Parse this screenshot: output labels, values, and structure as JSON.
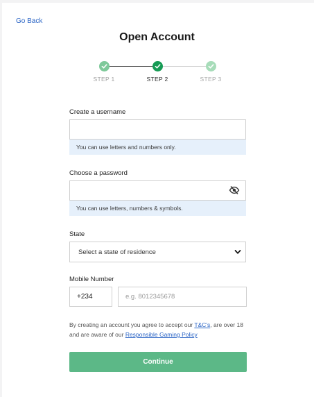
{
  "nav": {
    "go_back": "Go Back"
  },
  "page": {
    "title": "Open Account"
  },
  "stepper": {
    "steps": [
      {
        "label": "STEP 1",
        "state": "complete"
      },
      {
        "label": "STEP 2",
        "state": "current"
      },
      {
        "label": "STEP 3",
        "state": "upcoming"
      }
    ],
    "colors": {
      "step1": "#7ec99a",
      "step2": "#169b55",
      "step3": "#a7dcb9"
    }
  },
  "form": {
    "username": {
      "label": "Create a username",
      "value": "",
      "placeholder": "",
      "hint": "You can use letters and numbers only."
    },
    "password": {
      "label": "Choose a password",
      "value": "",
      "placeholder": "",
      "hint": "You can use letters, numbers & symbols.",
      "toggle_icon": "eye-slash-icon"
    },
    "state": {
      "label": "State",
      "selected": "Select a state of residence",
      "icon": "chevron-down-icon"
    },
    "mobile": {
      "label": "Mobile Number",
      "country_code": "+234",
      "value": "",
      "placeholder": "e.g. 8012345678"
    }
  },
  "terms": {
    "text_before": "By creating an account you agree to accept our ",
    "tc_link": "T&C's",
    "text_middle": ", are over 18 and are aware of our ",
    "policy_link": "Responsible Gaming Policy"
  },
  "actions": {
    "continue": "Continue"
  },
  "colors": {
    "accent": "#5cb887",
    "link": "#2a64c5",
    "hint_bg": "#e6f0fb"
  }
}
